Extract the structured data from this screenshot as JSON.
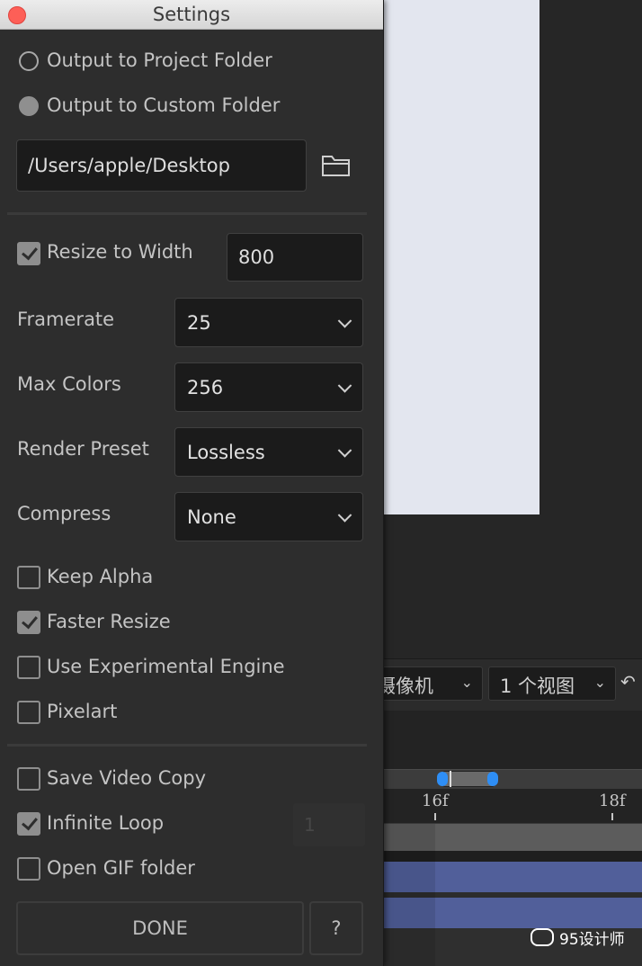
{
  "window": {
    "title": "Settings"
  },
  "output": {
    "project_folder_label": "Output to Project Folder",
    "custom_folder_label": "Output to Custom Folder",
    "path_value": "/Users/apple/Desktop"
  },
  "resize": {
    "label": "Resize to Width",
    "checked": true,
    "width_value": "800"
  },
  "framerate": {
    "label": "Framerate",
    "value": "25"
  },
  "max_colors": {
    "label": "Max Colors",
    "value": "256"
  },
  "render_preset": {
    "label": "Render Preset",
    "value": "Lossless"
  },
  "compress": {
    "label": "Compress",
    "value": "None"
  },
  "options": [
    {
      "label": "Keep Alpha",
      "checked": false
    },
    {
      "label": "Faster Resize",
      "checked": true
    },
    {
      "label": "Use Experimental Engine",
      "checked": false
    },
    {
      "label": "Pixelart",
      "checked": false
    }
  ],
  "export_options": [
    {
      "label": "Save Video Copy",
      "checked": false
    },
    {
      "label": "Infinite Loop",
      "checked": true
    },
    {
      "label": "Open GIF folder",
      "checked": false
    }
  ],
  "loop_count": "1",
  "buttons": {
    "done": "DONE",
    "help": "?"
  },
  "background_app": {
    "camera_select": "摄像机",
    "view_select": "1 个视图",
    "ruler_labels": [
      "16f",
      "18f"
    ],
    "watermark": "95设计师"
  },
  "colors": {
    "accent_blue": "#2e8ef5",
    "track_blue": "#515f9a",
    "close_red": "#fd5f57"
  }
}
